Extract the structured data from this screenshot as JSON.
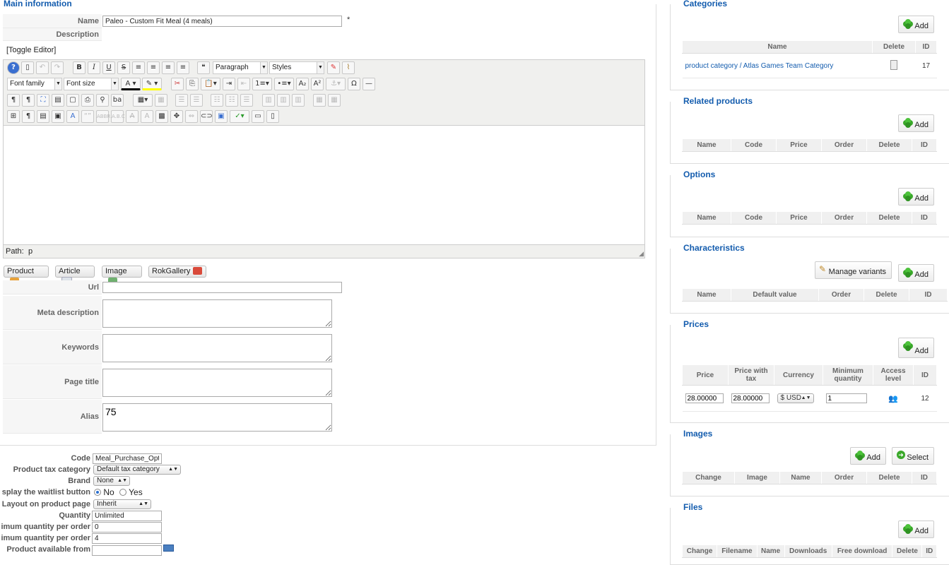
{
  "main": {
    "legend": "Main information",
    "name_label": "Name",
    "name_value": "Paleo - Custom Fit Meal (4 meals)",
    "required_mark": "*",
    "description_label": "Description",
    "toggle_editor": "[Toggle Editor]",
    "editor": {
      "format_select": "Paragraph",
      "styles_select": "Styles",
      "font_family_select": "Font family",
      "font_size_select": "Font size",
      "path_label": "Path:",
      "path_value": "p"
    },
    "insert_buttons": [
      "Product",
      "Article",
      "Image",
      "RokGallery"
    ],
    "url_label": "Url",
    "url_value": "",
    "meta_description_label": "Meta description",
    "keywords_label": "Keywords",
    "page_title_label": "Page title",
    "alias_label": "Alias",
    "alias_value": "75"
  },
  "lower": {
    "code_label": "Code",
    "code_value": "Meal_Purchase_Opt",
    "tax_label": "Product tax category",
    "tax_value": "Default tax category",
    "brand_label": "Brand",
    "brand_value": "None",
    "waitlist_label": "splay the waitlist button",
    "waitlist_no": "No",
    "waitlist_yes": "Yes",
    "layout_label": "Layout on product page",
    "layout_value": "Inherit",
    "quantity_label": "Quantity",
    "quantity_value": "Unlimited",
    "min_order_label": "imum quantity per order",
    "min_order_value": "0",
    "max_order_label": "imum quantity per order",
    "max_order_value": "4",
    "available_from_label": "Product available from"
  },
  "categories": {
    "legend": "Categories",
    "add": "Add",
    "columns": [
      "Name",
      "Delete",
      "ID"
    ],
    "rows": [
      {
        "name": "product category / Atlas Games Team Category",
        "id": "17"
      }
    ]
  },
  "related": {
    "legend": "Related products",
    "add": "Add",
    "columns": [
      "Name",
      "Code",
      "Price",
      "Order",
      "Delete",
      "ID"
    ]
  },
  "options": {
    "legend": "Options",
    "add": "Add",
    "columns": [
      "Name",
      "Code",
      "Price",
      "Order",
      "Delete",
      "ID"
    ]
  },
  "characteristics": {
    "legend": "Characteristics",
    "manage": "Manage variants",
    "add": "Add",
    "columns": [
      "Name",
      "Default value",
      "Order",
      "Delete",
      "ID"
    ]
  },
  "prices": {
    "legend": "Prices",
    "add": "Add",
    "columns": [
      "Price",
      "Price with tax",
      "Currency",
      "Minimum quantity",
      "Access level",
      "ID"
    ],
    "row": {
      "price": "28.00000",
      "price_tax": "28.00000",
      "currency": "$ USD",
      "min_qty": "1",
      "id": "12"
    }
  },
  "images": {
    "legend": "Images",
    "add": "Add",
    "select": "Select",
    "columns": [
      "Change",
      "Image",
      "Name",
      "Order",
      "Delete",
      "ID"
    ]
  },
  "files": {
    "legend": "Files",
    "add": "Add",
    "columns": [
      "Change",
      "Filename",
      "Name",
      "Downloads",
      "Free download",
      "Delete",
      "ID"
    ]
  },
  "colors": {
    "accent": "#135cae",
    "add_green": "#3aa82a"
  }
}
